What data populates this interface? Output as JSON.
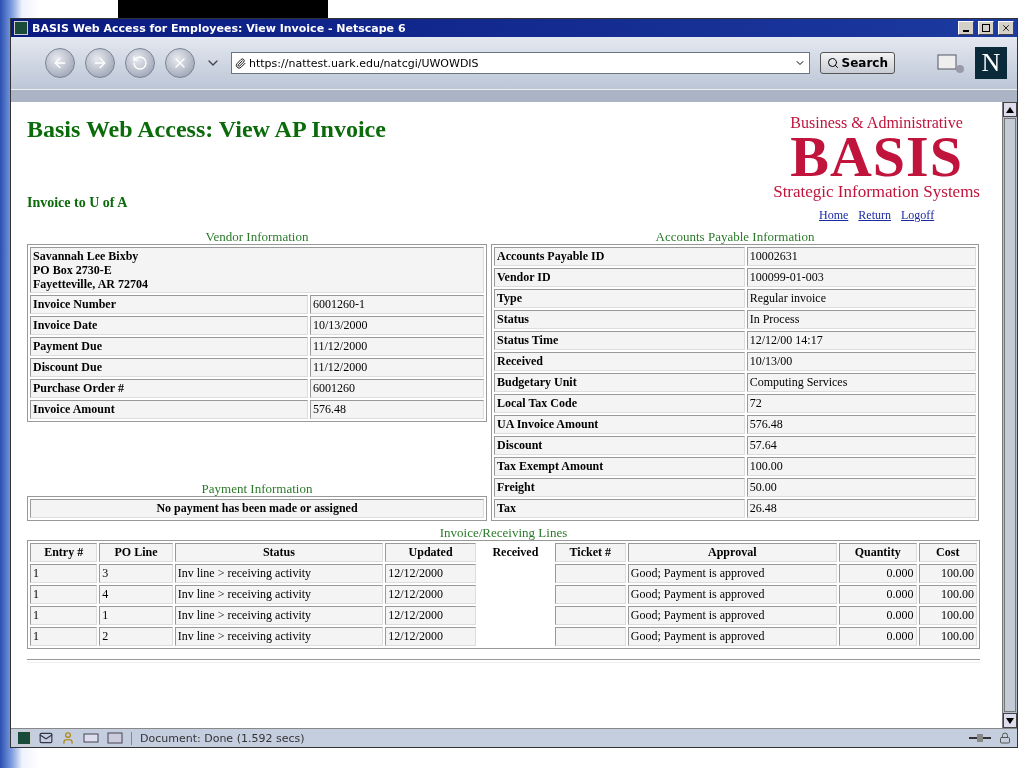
{
  "window": {
    "title": "BASIS Web Access for Employees: View Invoice - Netscape 6"
  },
  "toolbar": {
    "url": "https://nattest.uark.edu/natcgi/UWOWDIS",
    "search_button": "Search",
    "brand": "N"
  },
  "page": {
    "title": "Basis Web Access: View AP Invoice",
    "subtitle": "Invoice to U of A",
    "logo": {
      "top": "Business & Administrative",
      "main": "BASIS",
      "bottom": "Strategic Information Systems"
    },
    "nav_links": [
      "Home",
      "Return",
      "Logoff"
    ],
    "vendor": {
      "heading": "Vendor Information",
      "address": [
        "Savannah Lee Bixby",
        "PO Box 2730-E",
        "Fayetteville, AR 72704"
      ],
      "rows": [
        {
          "label": "Invoice Number",
          "value": "6001260-1"
        },
        {
          "label": "Invoice Date",
          "value": "10/13/2000"
        },
        {
          "label": "Payment Due",
          "value": "11/12/2000"
        },
        {
          "label": "Discount Due",
          "value": "11/12/2000"
        },
        {
          "label": "Purchase Order #",
          "value": "6001260"
        },
        {
          "label": "Invoice Amount",
          "value": "576.48"
        }
      ]
    },
    "payment": {
      "heading": "Payment Information",
      "message": "No payment has been made or assigned"
    },
    "accounts_payable": {
      "heading": "Accounts Payable Information",
      "rows": [
        {
          "label": "Accounts Payable ID",
          "value": "10002631"
        },
        {
          "label": "Vendor ID",
          "value": "100099-01-003"
        },
        {
          "label": "Type",
          "value": "Regular invoice"
        },
        {
          "label": "Status",
          "value": "In Process"
        },
        {
          "label": "Status Time",
          "value": "12/12/00 14:17"
        },
        {
          "label": "Received",
          "value": "10/13/00"
        },
        {
          "label": "Budgetary Unit",
          "value": "Computing Services"
        },
        {
          "label": "Local Tax Code",
          "value": "72"
        },
        {
          "label": "UA Invoice Amount",
          "value": "576.48"
        },
        {
          "label": "Discount",
          "value": "57.64"
        },
        {
          "label": "Tax Exempt Amount",
          "value": "100.00"
        },
        {
          "label": "Freight",
          "value": "50.00"
        },
        {
          "label": "Tax",
          "value": "26.48"
        }
      ]
    },
    "lines": {
      "heading": "Invoice/Receiving Lines",
      "columns": [
        "Entry #",
        "PO Line",
        "Status",
        "Updated",
        "Received",
        "Ticket #",
        "Approval",
        "Quantity",
        "Cost"
      ],
      "rows": [
        {
          "entry": "1",
          "po_line": "3",
          "status": "Inv line > receiving activity",
          "updated": "12/12/2000",
          "approval": "Good; Payment is approved",
          "quantity": "0.000",
          "cost": "100.00"
        },
        {
          "entry": "1",
          "po_line": "4",
          "status": "Inv line > receiving activity",
          "updated": "12/12/2000",
          "approval": "Good; Payment is approved",
          "quantity": "0.000",
          "cost": "100.00"
        },
        {
          "entry": "1",
          "po_line": "1",
          "status": "Inv line > receiving activity",
          "updated": "12/12/2000",
          "approval": "Good; Payment is approved",
          "quantity": "0.000",
          "cost": "100.00"
        },
        {
          "entry": "1",
          "po_line": "2",
          "status": "Inv line > receiving activity",
          "updated": "12/12/2000",
          "approval": "Good; Payment is approved",
          "quantity": "0.000",
          "cost": "100.00"
        }
      ]
    }
  },
  "status_bar": {
    "text": "Document: Done (1.592 secs)"
  }
}
